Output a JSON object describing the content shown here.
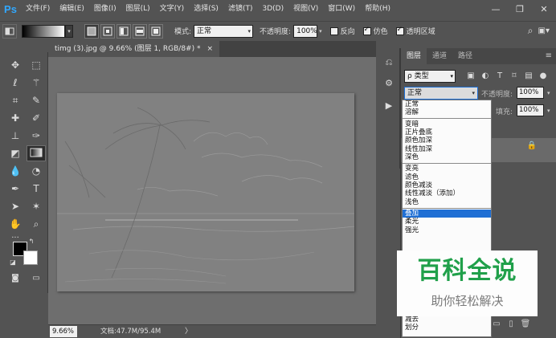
{
  "app": {
    "logo": "Ps"
  },
  "menu": [
    "文件(F)",
    "编辑(E)",
    "图像(I)",
    "图层(L)",
    "文字(Y)",
    "选择(S)",
    "滤镜(T)",
    "3D(D)",
    "视图(V)",
    "窗口(W)",
    "帮助(H)"
  ],
  "window_controls": {
    "minimize": "—",
    "restore": "❐",
    "close": "✕"
  },
  "options": {
    "mode_label": "模式:",
    "mode_value": "正常",
    "opacity_label": "不透明度:",
    "opacity_value": "100%",
    "reverse_label": "反向",
    "dither_label": "仿色",
    "transparency_label": "透明区域",
    "reverse_checked": false,
    "dither_checked": true,
    "transparency_checked": true
  },
  "document": {
    "tab_title": "timg (3).jpg @ 9.66% (图层 1, RGB/8#) *",
    "close": "×",
    "zoom": "9.66%",
    "info": "文档:47.7M/95.4M",
    "status_arrow": "〉"
  },
  "panels": {
    "tabs": [
      "图层",
      "通道",
      "路径"
    ],
    "menu_icon": "≡",
    "filter_type": "ρ 类型",
    "blend_mode": "正常",
    "opacity_label": "不透明度:",
    "opacity_value": "100%",
    "fill_label": "填充:",
    "fill_value": "100%"
  },
  "blend_groups": [
    [
      "正常",
      "溶解"
    ],
    [
      "变暗",
      "正片叠底",
      "颜色加深",
      "线性加深",
      "深色"
    ],
    [
      "变亮",
      "滤色",
      "颜色减淡",
      "线性减淡（添加）",
      "浅色"
    ],
    [
      "叠加",
      "柔光",
      "强光"
    ]
  ],
  "blend_tail": [
    "减去",
    "划分"
  ],
  "blend_selected": "叠加",
  "colors": {
    "foreground": "#000000",
    "background": "#ffffff",
    "accent": "#31a8ff",
    "selection": "#1f6fd4"
  },
  "watermark": {
    "title": "百科全说",
    "subtitle": "助你轻松解决"
  }
}
